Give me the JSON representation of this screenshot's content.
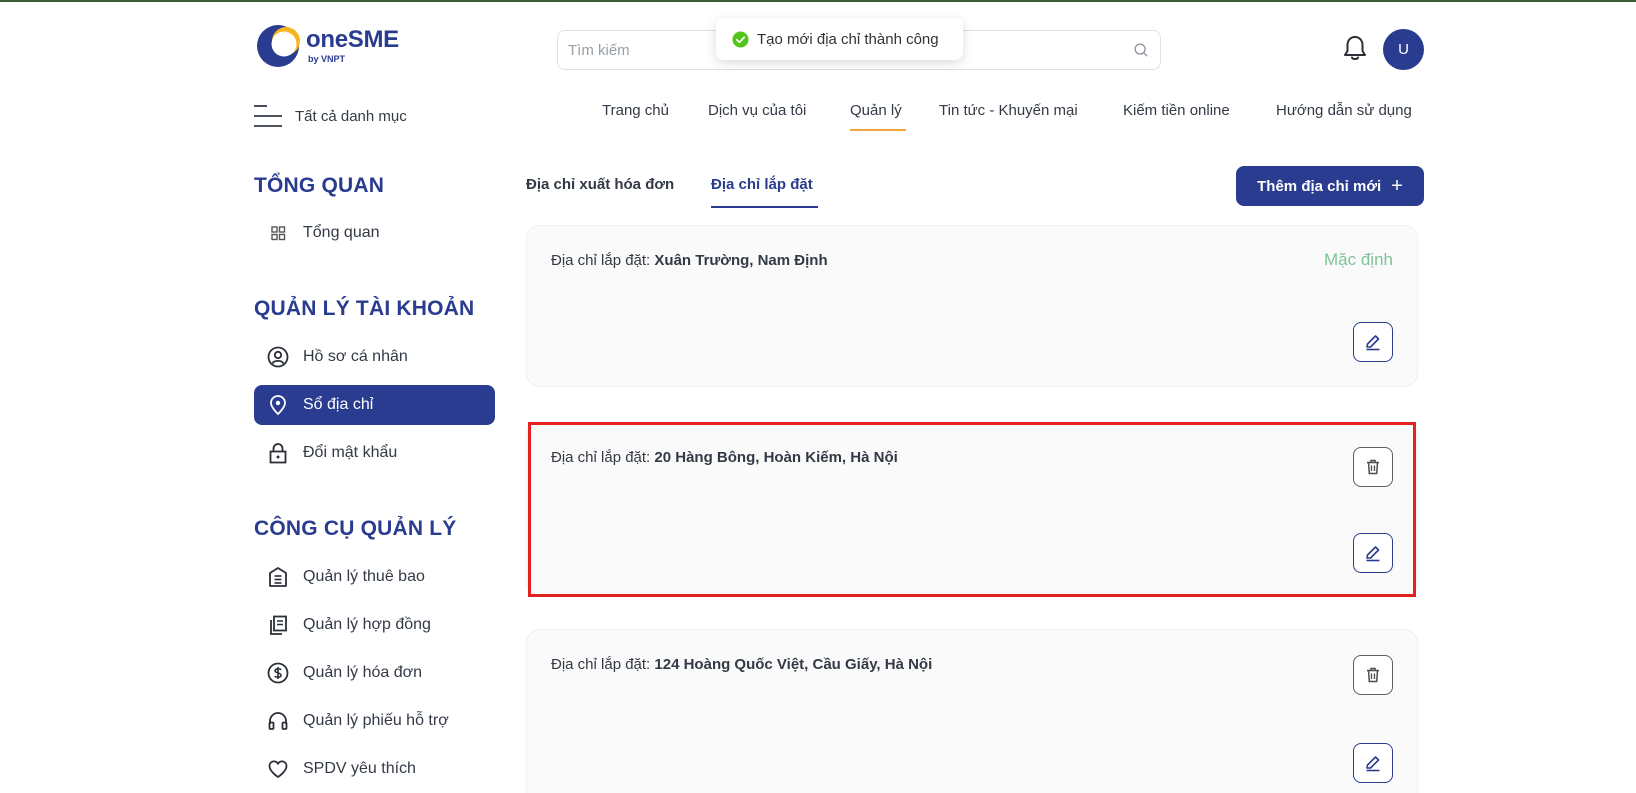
{
  "brand": {
    "name": "oneSME",
    "sub": "by VNPT"
  },
  "search": {
    "placeholder": "Tìm kiếm"
  },
  "toast": {
    "message": "Tạo mới địa chỉ thành công"
  },
  "user": {
    "avatar_letter": "U"
  },
  "catalog_label": "Tất cả danh mục",
  "nav": {
    "home": "Trang chủ",
    "services": "Dịch vụ của tôi",
    "manage": "Quản lý",
    "news": "Tin tức - Khuyến mại",
    "earn": "Kiếm tiền online",
    "guide": "Hướng dẫn sử dụng"
  },
  "sidebar": {
    "overview_heading": "TỔNG QUAN",
    "overview_item": "Tổng quan",
    "account_heading": "QUẢN LÝ TÀI KHOẢN",
    "profile": "Hồ sơ cá nhân",
    "address_book": "Sổ địa chỉ",
    "change_password": "Đổi mật khẩu",
    "tools_heading": "CÔNG CỤ QUẢN LÝ",
    "subscriptions": "Quản lý thuê bao",
    "contracts": "Quản lý hợp đồng",
    "invoices": "Quản lý hóa đơn",
    "tickets": "Quản lý phiếu hỗ trợ",
    "favorites": "SPDV yêu thích"
  },
  "tabs": {
    "billing": "Địa chỉ xuất hóa đơn",
    "installation": "Địa chỉ lắp đặt"
  },
  "add_button": {
    "label": "Thêm địa chỉ mới",
    "icon": "plus-icon"
  },
  "addresses": [
    {
      "label": "Địa chỉ lắp đặt:",
      "value": "Xuân Trường, Nam Định",
      "default_label": "Mặc định"
    },
    {
      "label": "Địa chỉ lắp đặt:",
      "value": "20 Hàng Bông, Hoàn Kiếm, Hà Nội"
    },
    {
      "label": "Địa chỉ lắp đặt:",
      "value": "124 Hoàng Quốc Việt, Cầu Giấy, Hà Nội"
    }
  ],
  "colors": {
    "primary": "#2a3c8f",
    "accent": "#f2a73b",
    "default": "#7cc496",
    "highlight": "#e52020",
    "success": "#52c41a"
  }
}
